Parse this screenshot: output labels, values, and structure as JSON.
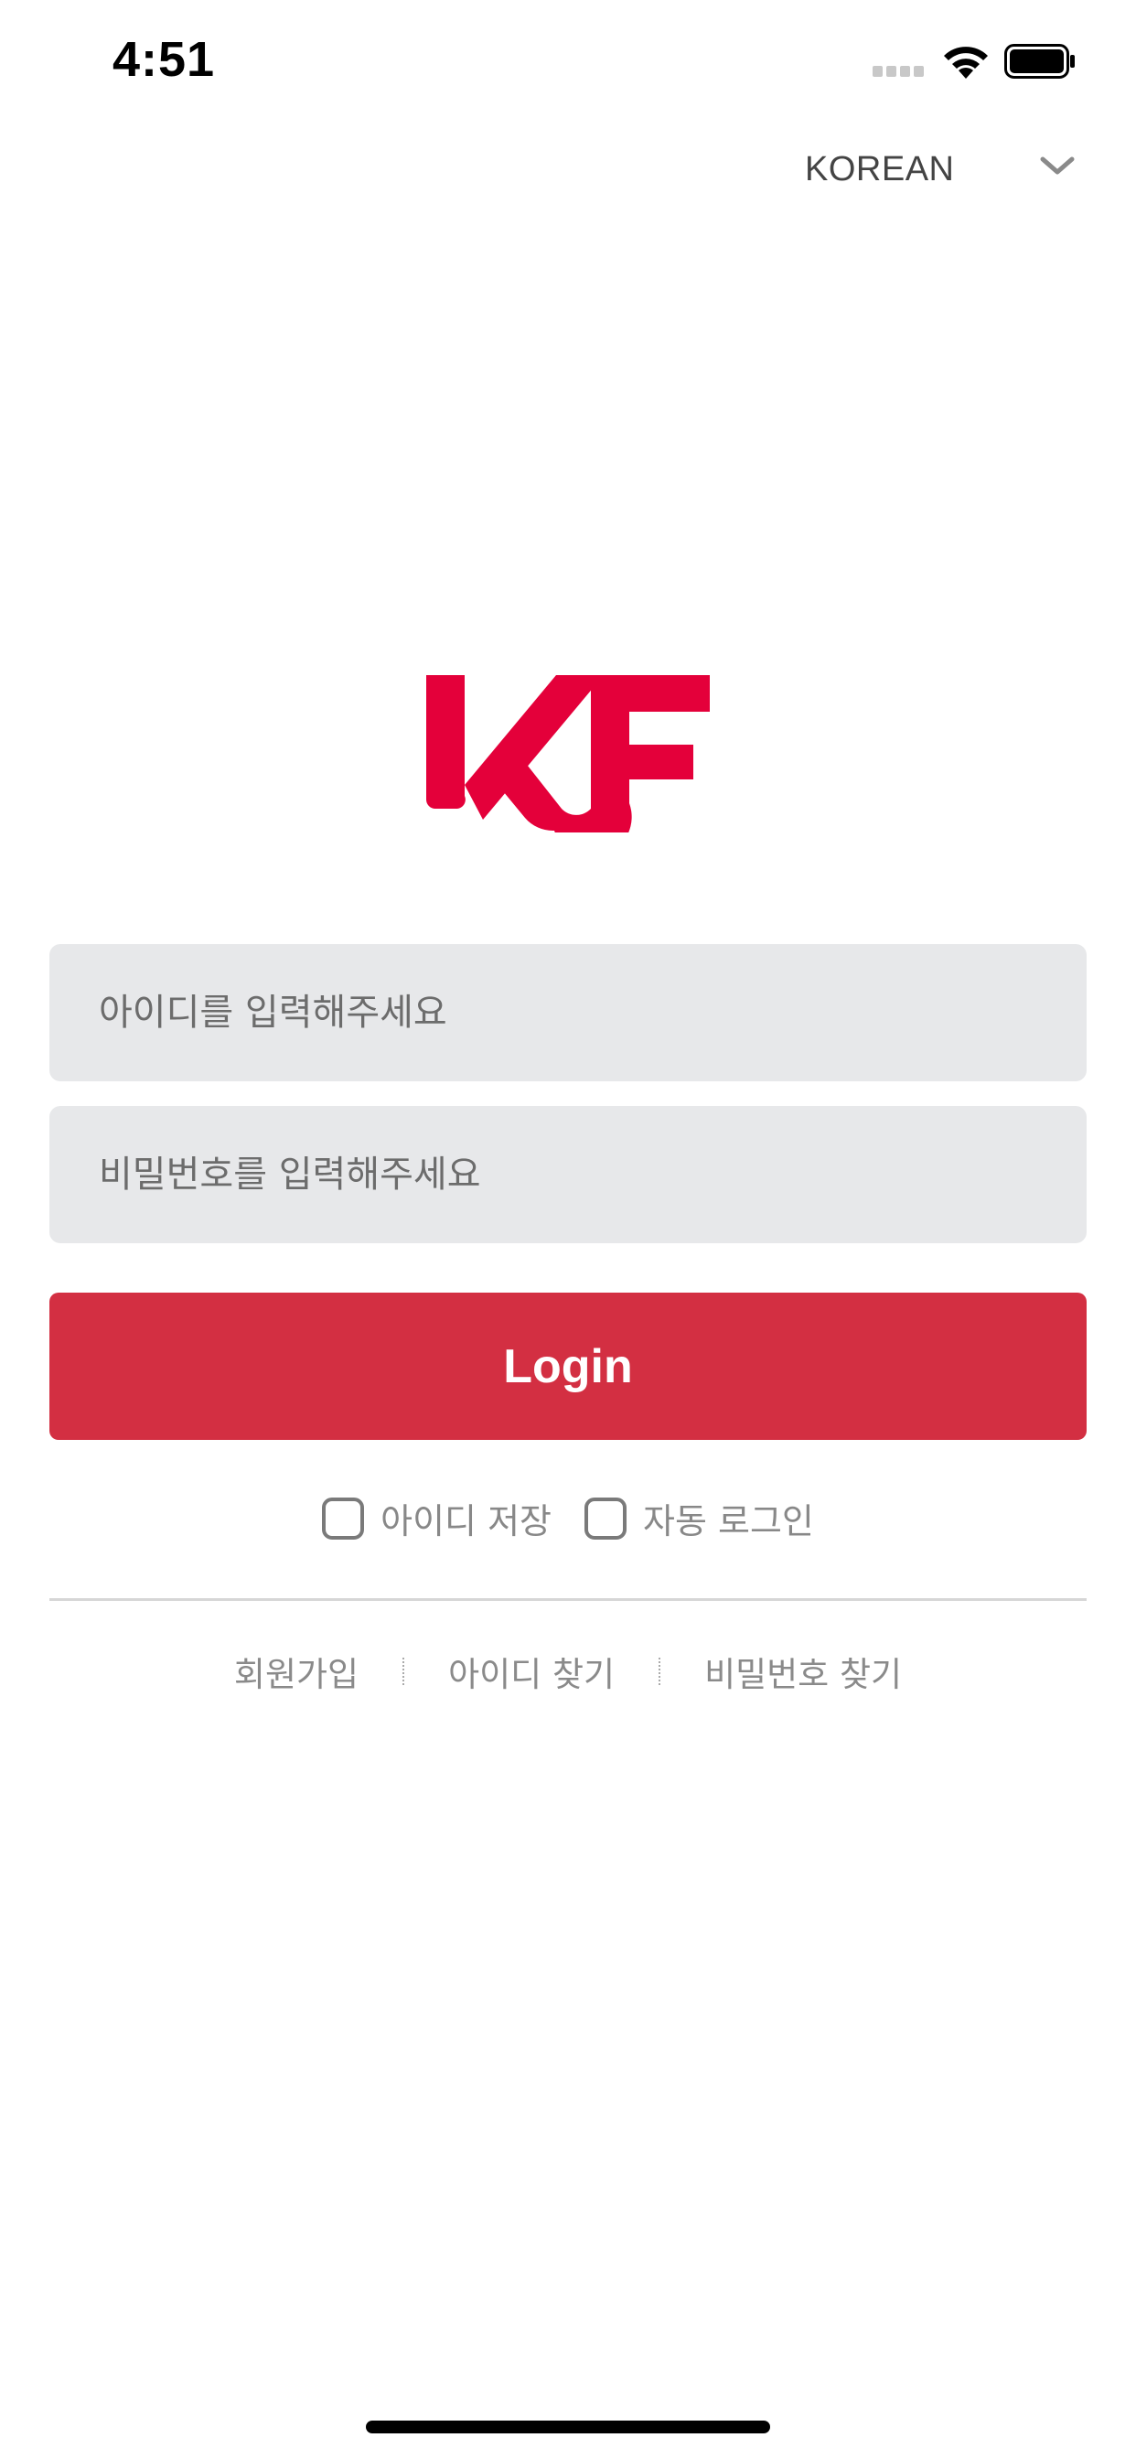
{
  "status_bar": {
    "time": "4:51"
  },
  "language": {
    "selected": "KOREAN"
  },
  "login_form": {
    "id_placeholder": "아이디를 입력해주세요",
    "password_placeholder": "비밀번호를 입력해주세요",
    "login_label": "Login"
  },
  "options": {
    "save_id_label": "아이디 저장",
    "auto_login_label": "자동 로그인"
  },
  "links": {
    "signup": "회원가입",
    "find_id": "아이디 찾기",
    "find_password": "비밀번호 찾기"
  },
  "logo": {
    "text": "KF"
  },
  "colors": {
    "brand": "#e4003a",
    "button": "#d32f42",
    "input_bg": "#e7e8ea"
  },
  "icons": [
    "signal-icon",
    "wifi-icon",
    "battery-icon",
    "chevron-down-icon",
    "checkbox-icon"
  ]
}
